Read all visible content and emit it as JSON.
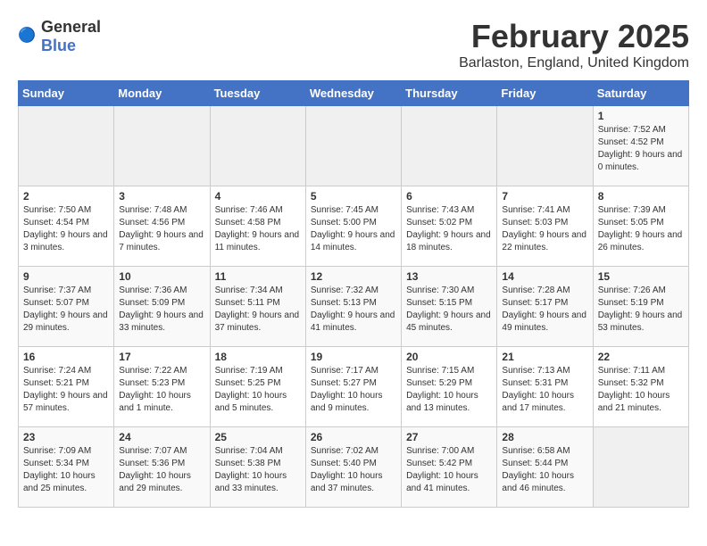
{
  "logo": {
    "text_general": "General",
    "text_blue": "Blue"
  },
  "title": "February 2025",
  "subtitle": "Barlaston, England, United Kingdom",
  "days_of_week": [
    "Sunday",
    "Monday",
    "Tuesday",
    "Wednesday",
    "Thursday",
    "Friday",
    "Saturday"
  ],
  "weeks": [
    [
      {
        "day": "",
        "info": "",
        "empty": true
      },
      {
        "day": "",
        "info": "",
        "empty": true
      },
      {
        "day": "",
        "info": "",
        "empty": true
      },
      {
        "day": "",
        "info": "",
        "empty": true
      },
      {
        "day": "",
        "info": "",
        "empty": true
      },
      {
        "day": "",
        "info": "",
        "empty": true
      },
      {
        "day": "1",
        "info": "Sunrise: 7:52 AM\nSunset: 4:52 PM\nDaylight: 9 hours and 0 minutes.",
        "empty": false
      }
    ],
    [
      {
        "day": "2",
        "info": "Sunrise: 7:50 AM\nSunset: 4:54 PM\nDaylight: 9 hours and 3 minutes.",
        "empty": false
      },
      {
        "day": "3",
        "info": "Sunrise: 7:48 AM\nSunset: 4:56 PM\nDaylight: 9 hours and 7 minutes.",
        "empty": false
      },
      {
        "day": "4",
        "info": "Sunrise: 7:46 AM\nSunset: 4:58 PM\nDaylight: 9 hours and 11 minutes.",
        "empty": false
      },
      {
        "day": "5",
        "info": "Sunrise: 7:45 AM\nSunset: 5:00 PM\nDaylight: 9 hours and 14 minutes.",
        "empty": false
      },
      {
        "day": "6",
        "info": "Sunrise: 7:43 AM\nSunset: 5:02 PM\nDaylight: 9 hours and 18 minutes.",
        "empty": false
      },
      {
        "day": "7",
        "info": "Sunrise: 7:41 AM\nSunset: 5:03 PM\nDaylight: 9 hours and 22 minutes.",
        "empty": false
      },
      {
        "day": "8",
        "info": "Sunrise: 7:39 AM\nSunset: 5:05 PM\nDaylight: 9 hours and 26 minutes.",
        "empty": false
      }
    ],
    [
      {
        "day": "9",
        "info": "Sunrise: 7:37 AM\nSunset: 5:07 PM\nDaylight: 9 hours and 29 minutes.",
        "empty": false
      },
      {
        "day": "10",
        "info": "Sunrise: 7:36 AM\nSunset: 5:09 PM\nDaylight: 9 hours and 33 minutes.",
        "empty": false
      },
      {
        "day": "11",
        "info": "Sunrise: 7:34 AM\nSunset: 5:11 PM\nDaylight: 9 hours and 37 minutes.",
        "empty": false
      },
      {
        "day": "12",
        "info": "Sunrise: 7:32 AM\nSunset: 5:13 PM\nDaylight: 9 hours and 41 minutes.",
        "empty": false
      },
      {
        "day": "13",
        "info": "Sunrise: 7:30 AM\nSunset: 5:15 PM\nDaylight: 9 hours and 45 minutes.",
        "empty": false
      },
      {
        "day": "14",
        "info": "Sunrise: 7:28 AM\nSunset: 5:17 PM\nDaylight: 9 hours and 49 minutes.",
        "empty": false
      },
      {
        "day": "15",
        "info": "Sunrise: 7:26 AM\nSunset: 5:19 PM\nDaylight: 9 hours and 53 minutes.",
        "empty": false
      }
    ],
    [
      {
        "day": "16",
        "info": "Sunrise: 7:24 AM\nSunset: 5:21 PM\nDaylight: 9 hours and 57 minutes.",
        "empty": false
      },
      {
        "day": "17",
        "info": "Sunrise: 7:22 AM\nSunset: 5:23 PM\nDaylight: 10 hours and 1 minute.",
        "empty": false
      },
      {
        "day": "18",
        "info": "Sunrise: 7:19 AM\nSunset: 5:25 PM\nDaylight: 10 hours and 5 minutes.",
        "empty": false
      },
      {
        "day": "19",
        "info": "Sunrise: 7:17 AM\nSunset: 5:27 PM\nDaylight: 10 hours and 9 minutes.",
        "empty": false
      },
      {
        "day": "20",
        "info": "Sunrise: 7:15 AM\nSunset: 5:29 PM\nDaylight: 10 hours and 13 minutes.",
        "empty": false
      },
      {
        "day": "21",
        "info": "Sunrise: 7:13 AM\nSunset: 5:31 PM\nDaylight: 10 hours and 17 minutes.",
        "empty": false
      },
      {
        "day": "22",
        "info": "Sunrise: 7:11 AM\nSunset: 5:32 PM\nDaylight: 10 hours and 21 minutes.",
        "empty": false
      }
    ],
    [
      {
        "day": "23",
        "info": "Sunrise: 7:09 AM\nSunset: 5:34 PM\nDaylight: 10 hours and 25 minutes.",
        "empty": false
      },
      {
        "day": "24",
        "info": "Sunrise: 7:07 AM\nSunset: 5:36 PM\nDaylight: 10 hours and 29 minutes.",
        "empty": false
      },
      {
        "day": "25",
        "info": "Sunrise: 7:04 AM\nSunset: 5:38 PM\nDaylight: 10 hours and 33 minutes.",
        "empty": false
      },
      {
        "day": "26",
        "info": "Sunrise: 7:02 AM\nSunset: 5:40 PM\nDaylight: 10 hours and 37 minutes.",
        "empty": false
      },
      {
        "day": "27",
        "info": "Sunrise: 7:00 AM\nSunset: 5:42 PM\nDaylight: 10 hours and 41 minutes.",
        "empty": false
      },
      {
        "day": "28",
        "info": "Sunrise: 6:58 AM\nSunset: 5:44 PM\nDaylight: 10 hours and 46 minutes.",
        "empty": false
      },
      {
        "day": "",
        "info": "",
        "empty": true
      }
    ]
  ]
}
